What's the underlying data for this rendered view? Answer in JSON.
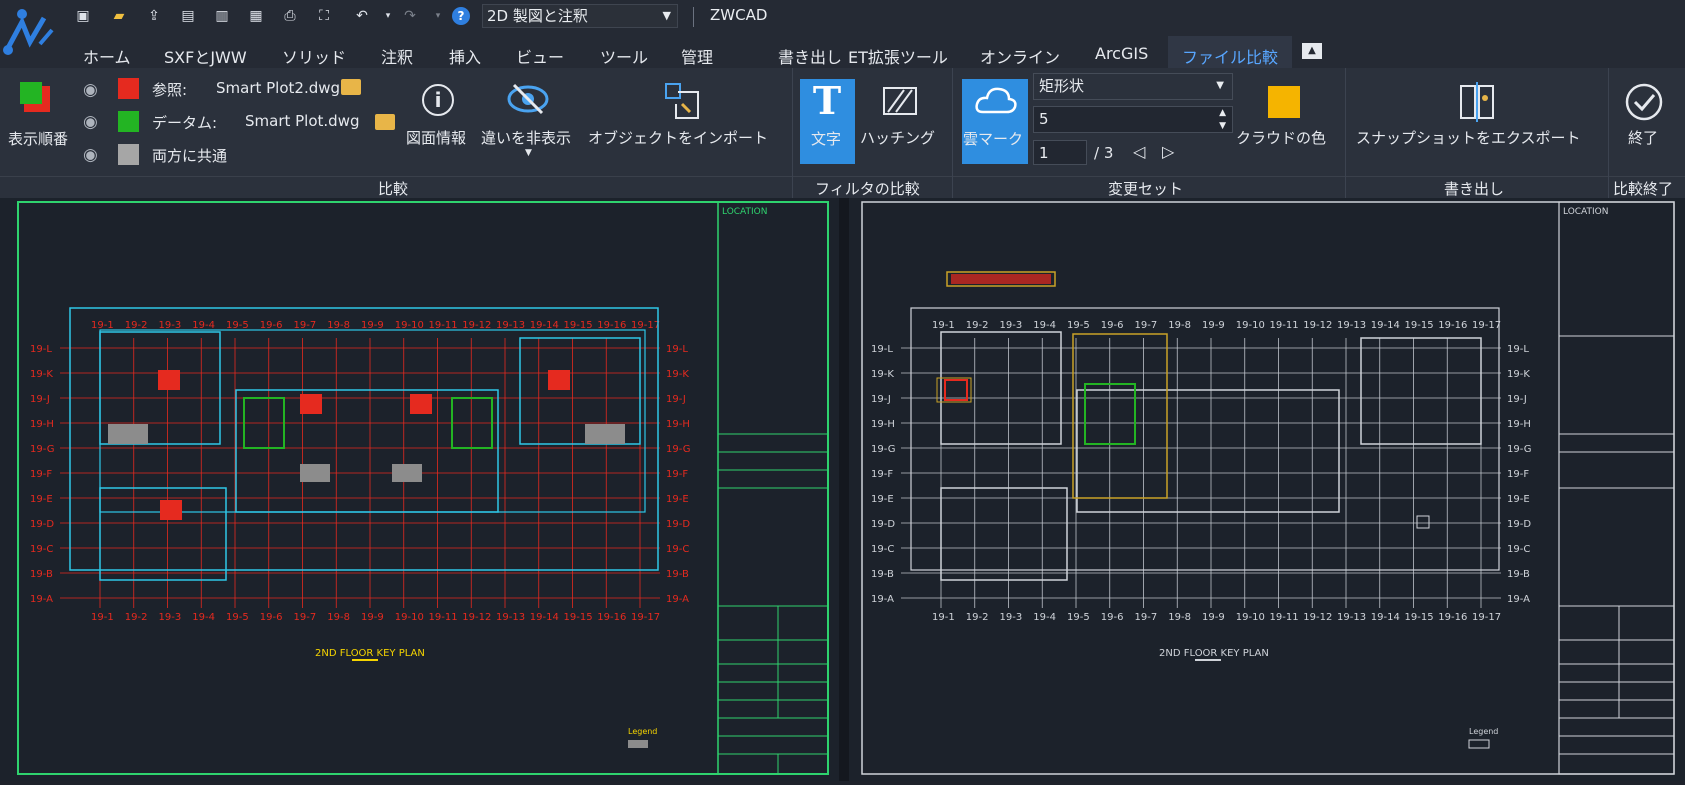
{
  "quick_access": {
    "workspace": "2D 製図と注釈",
    "app_title": "ZWCAD",
    "icons": [
      "new-icon",
      "open-icon",
      "upload-icon",
      "save-icon",
      "save-as-icon",
      "sheet-set-icon",
      "print-icon",
      "zoom-extents-icon",
      "undo-icon",
      "redo-icon",
      "help-icon"
    ]
  },
  "tabs": [
    "ホーム",
    "SXFとJWW",
    "ソリッド",
    "注釈",
    "挿入",
    "ビュー",
    "ツール",
    "管理",
    "書き出し",
    "ET拡張ツール",
    "オンライン",
    "ArcGIS",
    "ファイル比較"
  ],
  "active_tab": "ファイル比較",
  "ribbon": {
    "compare": {
      "group_label": "比較",
      "display_order_label": "表示順番",
      "reference_label": "参照:",
      "reference_file": "Smart Plot2.dwg",
      "datum_label": "データム:",
      "datum_file": "Smart Plot.dwg",
      "common_label": "両方に共通",
      "drawing_info_label": "図面情報",
      "hide_diff_label": "違いを非表示",
      "import_objects_label": "オブジェクトをインポート",
      "colors": {
        "reference": "#e52a1f",
        "datum": "#23b423",
        "common": "#a6a6a6"
      }
    },
    "filter": {
      "group_label": "フィルタの比較",
      "text_label": "文字",
      "hatch_label": "ハッチング"
    },
    "changeset": {
      "group_label": "変更セット",
      "cloud_label": "雲マーク",
      "shape_value": "矩形状",
      "size_value": "5",
      "page_value": "1",
      "page_total": "/ 3",
      "cloud_color_label": "クラウドの色",
      "cloud_color": "#f5b400"
    },
    "export": {
      "group_label": "書き出し",
      "snapshot_label": "スナップショットをエクスポート"
    },
    "end": {
      "group_label": "比較終了",
      "end_label": "終了"
    }
  },
  "drawing": {
    "title": "2ND FLOOR KEY PLAN",
    "location_label": "LOCATION",
    "legend_label": "Legend",
    "grid_top": [
      "19-1",
      "19-2",
      "19-3",
      "19-4",
      "19-5",
      "19-6",
      "19-7",
      "19-8",
      "19-9",
      "19-10",
      "19-11",
      "19-12",
      "19-13",
      "19-14",
      "19-15",
      "19-16",
      "19-17"
    ],
    "grid_side": [
      "19-L",
      "19-K",
      "19-J",
      "19-H",
      "19-G",
      "19-F",
      "19-E",
      "19-D",
      "19-C",
      "19-B",
      "19-A"
    ]
  }
}
